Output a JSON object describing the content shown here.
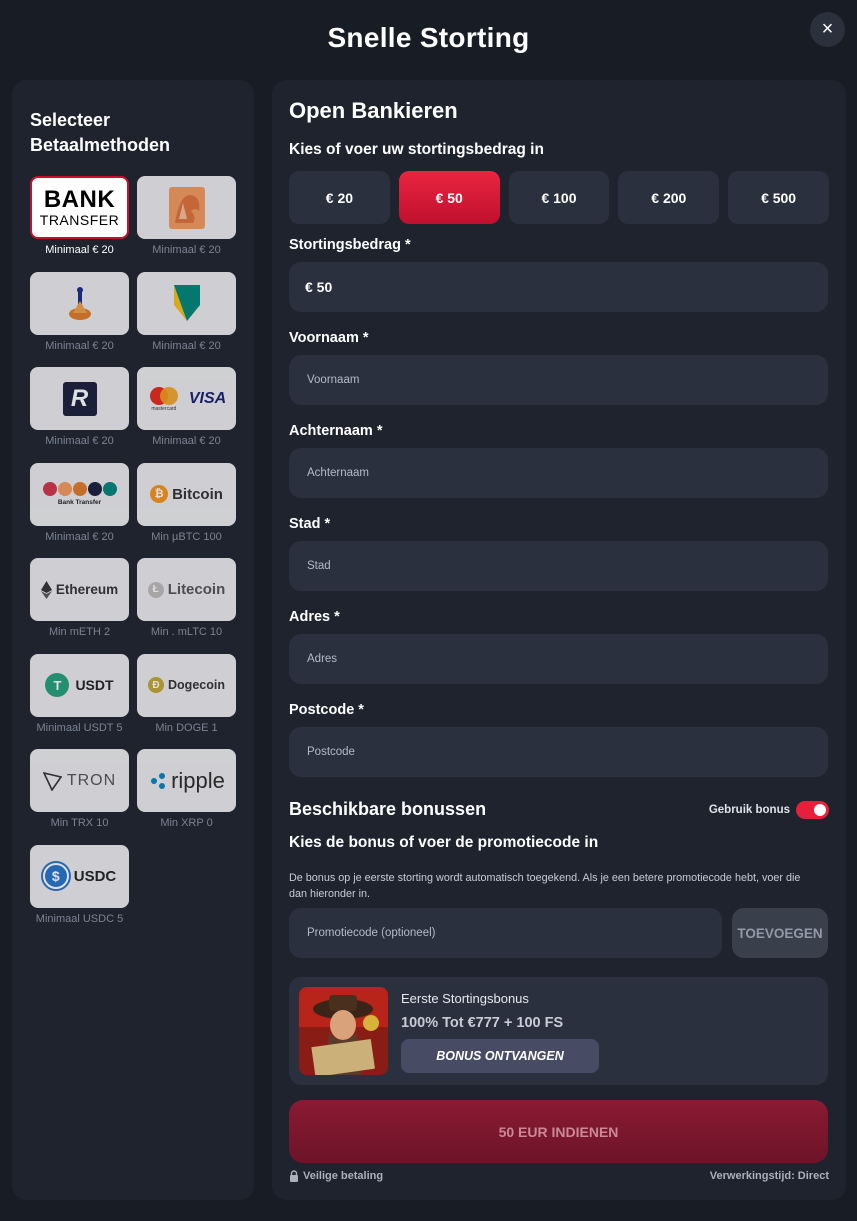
{
  "modal": {
    "title": "Snelle Storting",
    "close_icon": "×"
  },
  "methods_panel": {
    "title": "Selecteer Betaalmethoden",
    "methods": [
      {
        "id": "bank-transfer",
        "caption": "Minimaal € 20",
        "logo_line1": "BANK",
        "logo_line2": "TRANSFER",
        "active": true
      },
      {
        "id": "ing",
        "caption": "Minimaal € 20"
      },
      {
        "id": "rabobank",
        "caption": "Minimaal € 20"
      },
      {
        "id": "abn-amro",
        "caption": "Minimaal € 20"
      },
      {
        "id": "revolut",
        "caption": "Minimaal € 20",
        "logo": "R"
      },
      {
        "id": "mastercard-visa",
        "caption": "Minimaal € 20",
        "logo": "VISA",
        "logo_small": "mastercard"
      },
      {
        "id": "bank-transfer-multi",
        "caption": "Minimaal € 20",
        "logo": "Bank Transfer"
      },
      {
        "id": "bitcoin",
        "caption": "Min µBTC 100",
        "logo": "Bitcoin",
        "symbol": "₿"
      },
      {
        "id": "ethereum",
        "caption": "Min mETH 2",
        "logo": "Ethereum"
      },
      {
        "id": "litecoin",
        "caption": "Min . mLTC 10",
        "logo": "Litecoin",
        "symbol": "Ł"
      },
      {
        "id": "usdt",
        "caption": "Minimaal USDT 5",
        "logo": "USDT",
        "symbol": "T"
      },
      {
        "id": "dogecoin",
        "caption": "Min DOGE 1",
        "logo": "Dogecoin",
        "symbol": "Ð"
      },
      {
        "id": "tron",
        "caption": "Min TRX 10",
        "logo": "TRON"
      },
      {
        "id": "ripple",
        "caption": "Min XRP 0",
        "logo": "ripple"
      },
      {
        "id": "usdc",
        "caption": "Minimaal USDC 5",
        "logo": "USDC",
        "symbol": "$"
      }
    ]
  },
  "form": {
    "title": "Open Bankieren",
    "amount_prompt": "Kies of voer uw stortingsbedrag in",
    "amounts": [
      "€ 20",
      "€ 50",
      "€ 100",
      "€ 200",
      "€ 500"
    ],
    "selected_amount": "€ 50",
    "deposit_label": "Stortingsbedrag *",
    "deposit_value": "€ 50",
    "fields": [
      {
        "label": "Voornaam *",
        "placeholder": "Voornaam"
      },
      {
        "label": "Achternaam *",
        "placeholder": "Achternaam"
      },
      {
        "label": "Stad *",
        "placeholder": "Stad"
      },
      {
        "label": "Adres *",
        "placeholder": "Adres"
      },
      {
        "label": "Postcode *",
        "placeholder": "Postcode"
      }
    ]
  },
  "bonus": {
    "title": "Beschikbare bonussen",
    "toggle_label": "Gebruik bonus",
    "toggle_on": true,
    "subtitle": "Kies de bonus of voer de promotiecode in",
    "description": "De bonus op je eerste storting wordt automatisch toegekend. Als je een betere promotiecode hebt, voer die dan hieronder in.",
    "promo_placeholder": "Promotiecode (optioneel)",
    "promo_button": "TOEVOEGEN",
    "card": {
      "name": "Eerste Stortingsbonus",
      "offer": "100% Tot €777 + 100 FS",
      "claim_button": "BONUS ONTVANGEN"
    }
  },
  "submit_label": "50 EUR INDIENEN",
  "footer": {
    "secure": "Veilige betaling",
    "processing": "Verwerkingstijd: Direct"
  },
  "colors": {
    "background": "#181c25",
    "panel": "#1e232e",
    "field": "#2a303d",
    "accent": "#e61f3b"
  }
}
